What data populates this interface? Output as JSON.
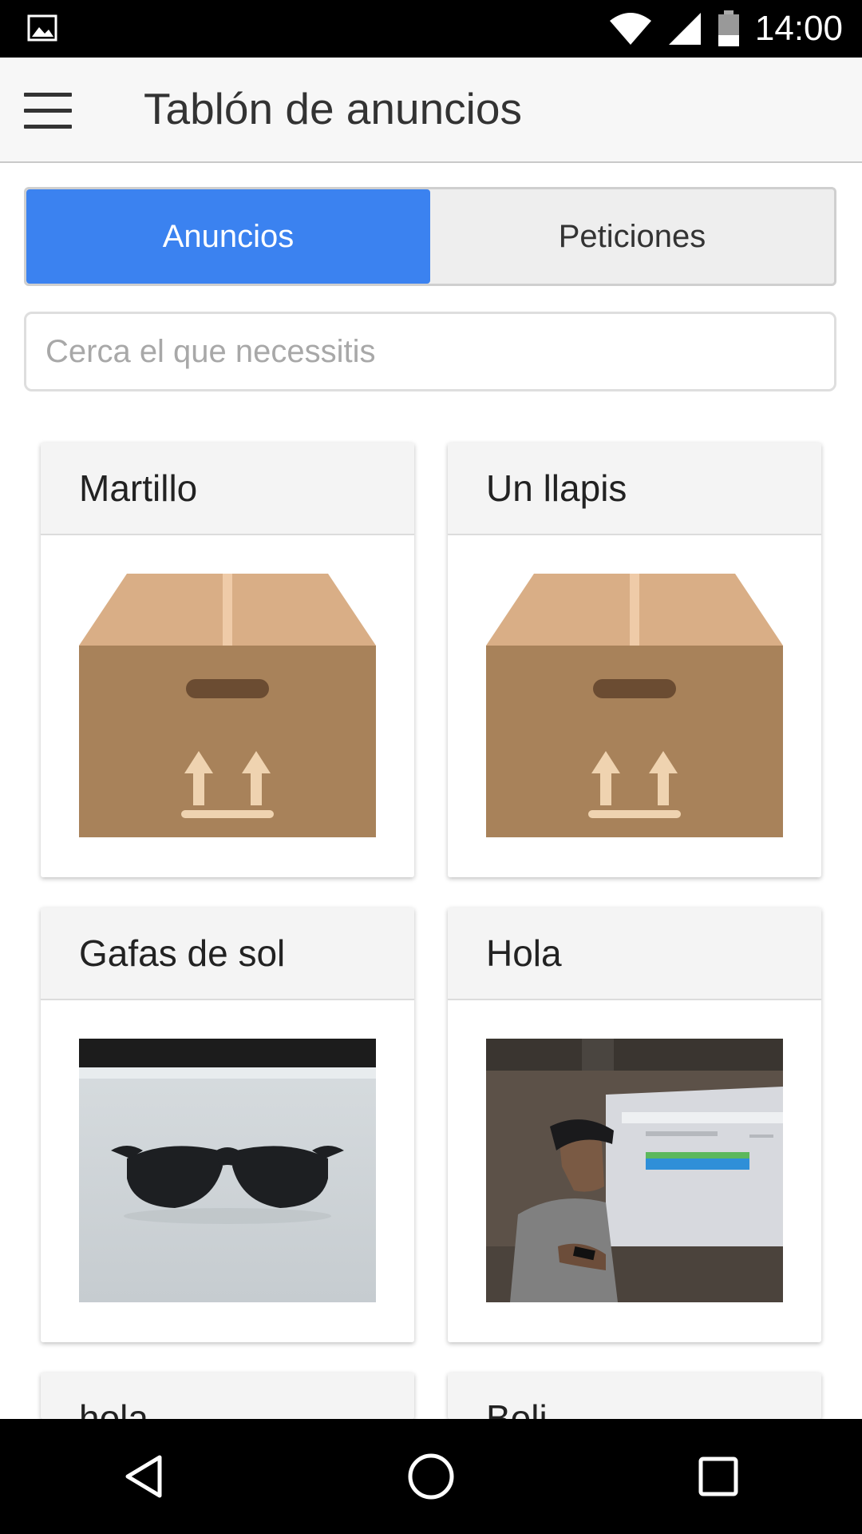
{
  "status_bar": {
    "time": "14:00",
    "icons": [
      "image-icon",
      "wifi-icon",
      "signal-icon",
      "battery-icon"
    ]
  },
  "app_bar": {
    "title": "Tablón de anuncios",
    "menu_icon": "hamburger-menu-icon"
  },
  "tabs": [
    {
      "label": "Anuncios",
      "active": true
    },
    {
      "label": "Peticiones",
      "active": false
    }
  ],
  "search": {
    "placeholder": "Cerca el que necessitis",
    "value": ""
  },
  "cards": [
    {
      "title": "Martillo",
      "image": "box-placeholder"
    },
    {
      "title": "Un llapis",
      "image": "box-placeholder"
    },
    {
      "title": "Gafas de sol",
      "image": "sunglasses-photo"
    },
    {
      "title": "Hola",
      "image": "person-photo"
    },
    {
      "title": "hola",
      "image": ""
    },
    {
      "title": "Boli",
      "image": ""
    }
  ],
  "nav_bar": [
    "back-icon",
    "home-icon",
    "recents-icon"
  ],
  "colors": {
    "accent": "#3b82f0",
    "box_dark": "#a8825a",
    "box_light": "#d9ae86"
  }
}
